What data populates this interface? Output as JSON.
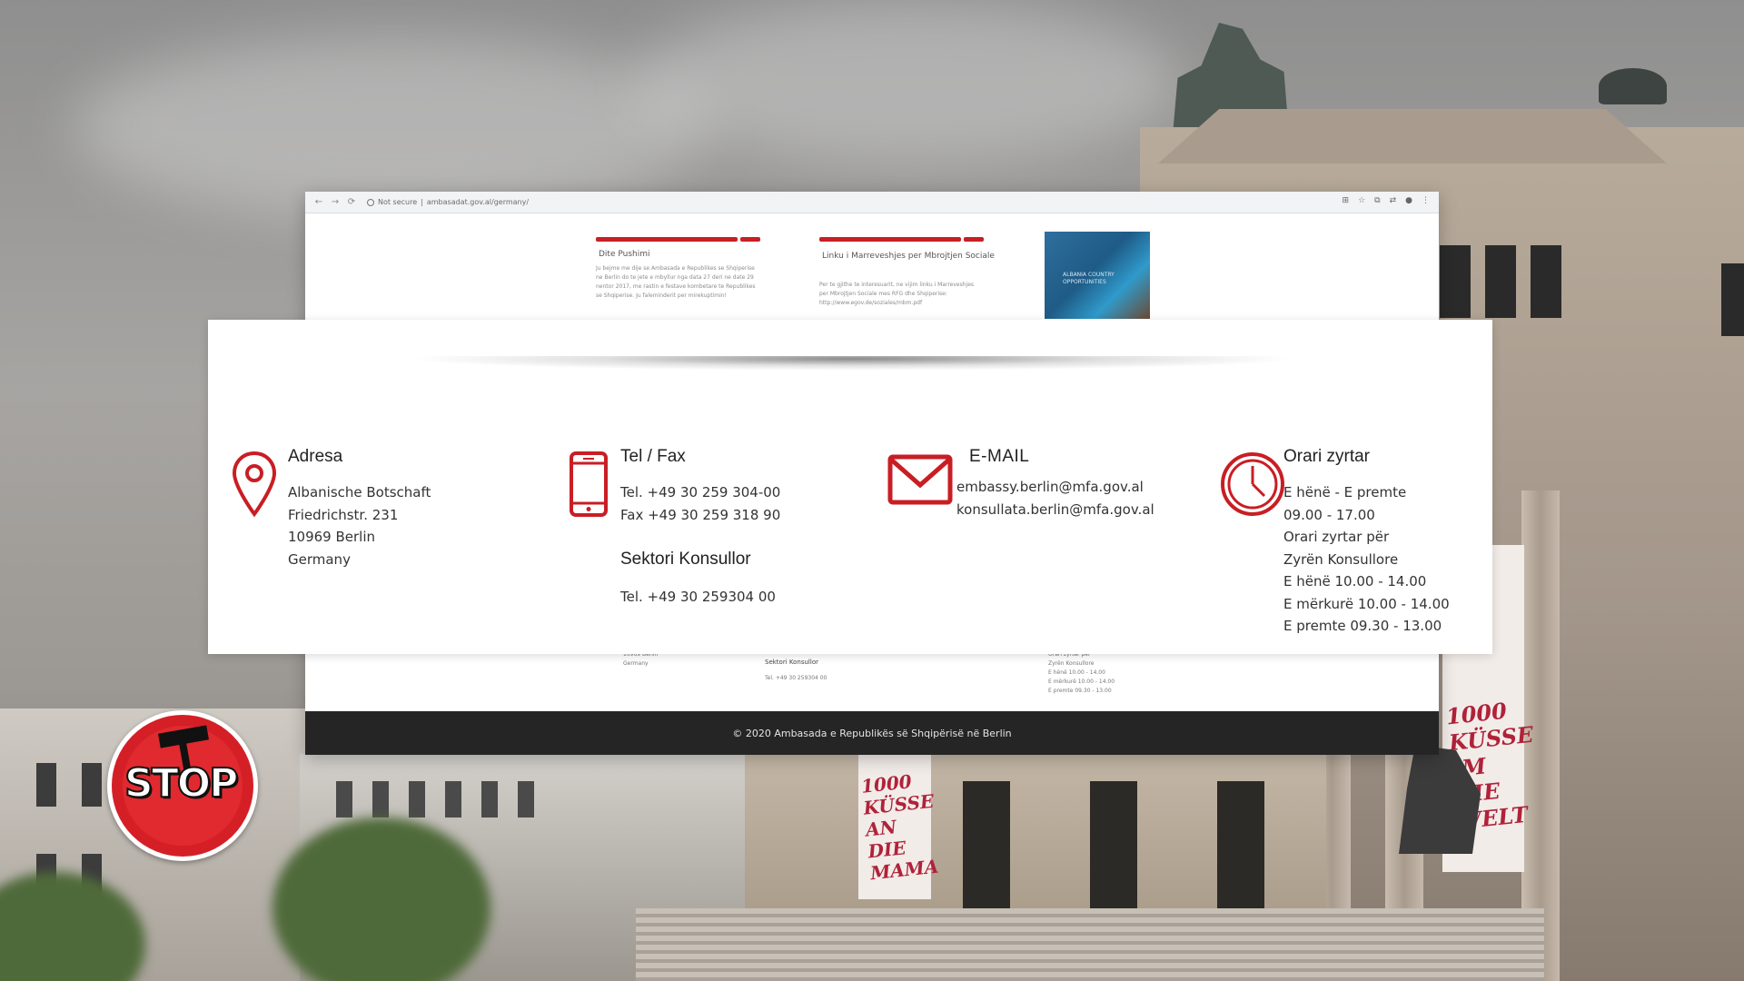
{
  "browser": {
    "nav_back": "←",
    "nav_forward": "→",
    "nav_reload": "⟳",
    "url_prefix": "Not secure",
    "url": "ambasadat.gov.al/germany/",
    "tools": [
      "⊞",
      "☆",
      "⧉",
      "⇄",
      "●",
      "⋮"
    ]
  },
  "top_strip": {
    "item1_title": "Dite Pushimi",
    "item1_text": "Ju bejme me dije se Ambasada e Republikes se Shqiperise ne Berlin do te jete e mbyllur nga data 27 deri ne date 29 nentor 2017, me rastin e festave kombetare te Republikes se Shqiperise. Ju faleminderit per mirekuptimin!",
    "item2_title": "Linku i Marreveshjes per Mbrojtjen Sociale",
    "item2_text": "Per te gjithe te interesuarit, ne vijim linku i Marreveshjes per Mbrojtjen Sociale mes RFG dhe Shqiperise: http://www.egov.de/soziales/mbm.pdf",
    "thumb_caption": "ALBANIA COUNTRY OPPORTUNITIES"
  },
  "bottom_strip": {
    "addr_lines": [
      "10969 Berlin",
      "Germany"
    ],
    "consul_title": "Sektori Konsullor",
    "consul_tel": "Tel. +49 30 259304 00",
    "hours_lines": [
      "Orari zyrtar për",
      "Zyrën Konsullore",
      "E hënë 10.00 - 14.00",
      "E mërkurë 10.00 - 14.00",
      "E premte 09.30 - 13.00"
    ]
  },
  "footer": {
    "copyright": "© 2020 Ambasada e Republikës së Shqipërisë në Berlin"
  },
  "contact": {
    "address": {
      "title": "Adresa",
      "lines": [
        "Albanische Botschaft",
        "Friedrichstr. 231",
        "10969 Berlin",
        "Germany"
      ]
    },
    "phone": {
      "title": "Tel / Fax",
      "tel": "Tel. +49 30 259 304-00",
      "fax": "Fax +49 30 259 318 90",
      "consular_title": "Sektori Konsullor",
      "consular_tel": "Tel. +49 30 259304 00"
    },
    "email": {
      "title": "E-MAIL",
      "lines": [
        "embassy.berlin@mfa.gov.al",
        "konsullata.berlin@mfa.gov.al"
      ]
    },
    "hours": {
      "title": "Orari zyrtar",
      "lines": [
        "E hënë - E premte",
        "09.00 - 17.00",
        "Orari zyrtar për",
        "Zyrën Konsullore",
        "E hënë 10.00 - 14.00",
        "E mërkurë 10.00 - 14.00",
        "E premte 09.30 - 13.00"
      ]
    }
  },
  "logo": {
    "text": "STOP"
  },
  "background": {
    "banner_text": "1000 KÜSSE AN DIE MAMA",
    "banner_text_right": "1000 KÜSSE IM DIE WELT"
  },
  "colors": {
    "accent_red": "#c81e24",
    "footer_bg": "#252525"
  }
}
